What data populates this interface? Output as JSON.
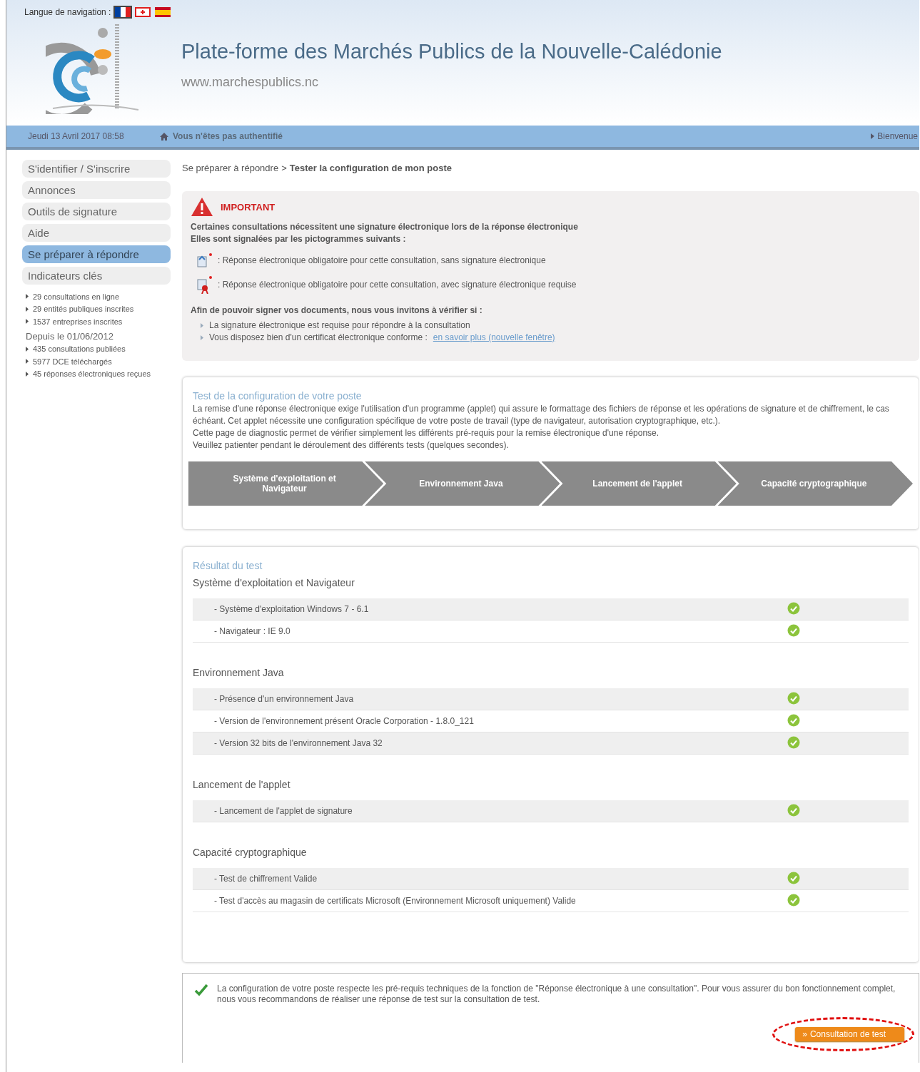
{
  "header": {
    "language_label": "Langue de navigation :",
    "languages": [
      {
        "kind": "fr",
        "selected": true
      },
      {
        "kind": "en",
        "selected": false
      },
      {
        "kind": "es",
        "selected": false
      }
    ],
    "title": "Plate-forme des Marchés Publics de la Nouvelle-Calédonie",
    "url": "www.marchespublics.nc"
  },
  "status_bar": {
    "date": "Jeudi 13 Avril 2017 08:58",
    "auth": "Vous n'êtes pas authentifié",
    "welcome": "Bienvenue"
  },
  "sidebar": {
    "items": [
      {
        "label": "S'identifier / S'inscrire",
        "selected": false
      },
      {
        "label": "Annonces",
        "selected": false
      },
      {
        "label": "Outils de signature",
        "selected": false
      },
      {
        "label": "Aide",
        "selected": false
      },
      {
        "label": "Se préparer à répondre",
        "selected": true
      },
      {
        "label": "Indicateurs clés",
        "selected": false
      }
    ],
    "stats": [
      "29 consultations en ligne",
      "29 entités publiques inscrites",
      "1537 entreprises inscrites"
    ],
    "since_label": "Depuis le 01/06/2012",
    "since_stats": [
      "435 consultations publiées",
      "5977 DCE téléchargés",
      "45 réponses électroniques reçues"
    ]
  },
  "breadcrumb": {
    "parent": "Se préparer à répondre",
    "separator": ">",
    "current": "Tester la configuration de mon poste"
  },
  "important": {
    "title": "IMPORTANT",
    "lines": [
      "Certaines consultations nécessitent une signature électronique lors de la réponse électronique",
      "Elles sont signalées par les pictogrammes suivants :"
    ],
    "pictograms": [
      {
        "kind": "unsigned",
        "text": ": Réponse électronique obligatoire pour cette consultation, sans signature électronique"
      },
      {
        "kind": "signed",
        "text": ": Réponse électronique obligatoire pour cette consultation, avec signature électronique requise"
      }
    ],
    "check_intro": "Afin de pouvoir signer vos documents, nous vous invitons à vérifier si :",
    "checks": [
      {
        "text": "La signature électronique est requise pour répondre à la consultation"
      },
      {
        "text": "Vous disposez bien d'un certificat électronique conforme :",
        "link": "en savoir plus (nouvelle fenêtre)"
      }
    ]
  },
  "config_test": {
    "title": "Test de la configuration de votre poste",
    "paragraphs": [
      "La remise d'une réponse électronique exige l'utilisation d'un programme (applet) qui assure le formattage des fichiers de réponse et les opérations de signature et de chiffrement, le cas échéant. Cet applet nécessite une configuration spécifique de votre poste de travail (type de navigateur, autorisation cryptographique, etc.).",
      "Cette page de diagnostic permet de vérifier simplement les différents pré-requis pour la remise électronique d'une réponse.",
      "Veuillez patienter pendant le déroulement des différents tests (quelques secondes)."
    ],
    "steps": [
      "Système d'exploitation et Navigateur",
      "Environnement Java",
      "Lancement de l'applet",
      "Capacité cryptographique"
    ]
  },
  "results": {
    "title": "Résultat du test",
    "sections": [
      {
        "title": "Système d'exploitation et Navigateur",
        "rows": [
          {
            "label": "- Système d'exploitation Windows 7 - 6.1",
            "passed": true
          },
          {
            "label": "- Navigateur : IE 9.0",
            "passed": true
          }
        ]
      },
      {
        "title": "Environnement Java",
        "rows": [
          {
            "label": "- Présence d'un environnement Java",
            "passed": true
          },
          {
            "label": "- Version de l'environnement présent Oracle Corporation - 1.8.0_121",
            "passed": true
          },
          {
            "label": "- Version 32 bits de l'environnement Java 32",
            "passed": true
          }
        ]
      },
      {
        "title": "Lancement de l'applet",
        "rows": [
          {
            "label": "- Lancement de l'applet de signature",
            "passed": true
          }
        ]
      },
      {
        "title": "Capacité cryptographique",
        "rows": [
          {
            "label": "- Test de chiffrement Valide",
            "passed": true
          },
          {
            "label": "- Test d'accès au magasin de certificats Microsoft (Environnement Microsoft uniquement) Valide",
            "passed": true
          }
        ]
      }
    ]
  },
  "conclusion": {
    "success": true,
    "text": "La configuration de votre poste respecte les pré-requis techniques de la fonction de \"Réponse électronique à une consultation\". Pour vous assurer du bon fonctionnement complet, nous vous recommandons de réaliser une réponse de test sur la consultation de test.",
    "button": {
      "icon_text": "»",
      "label": "Consultation de test",
      "annotated": true
    }
  }
}
